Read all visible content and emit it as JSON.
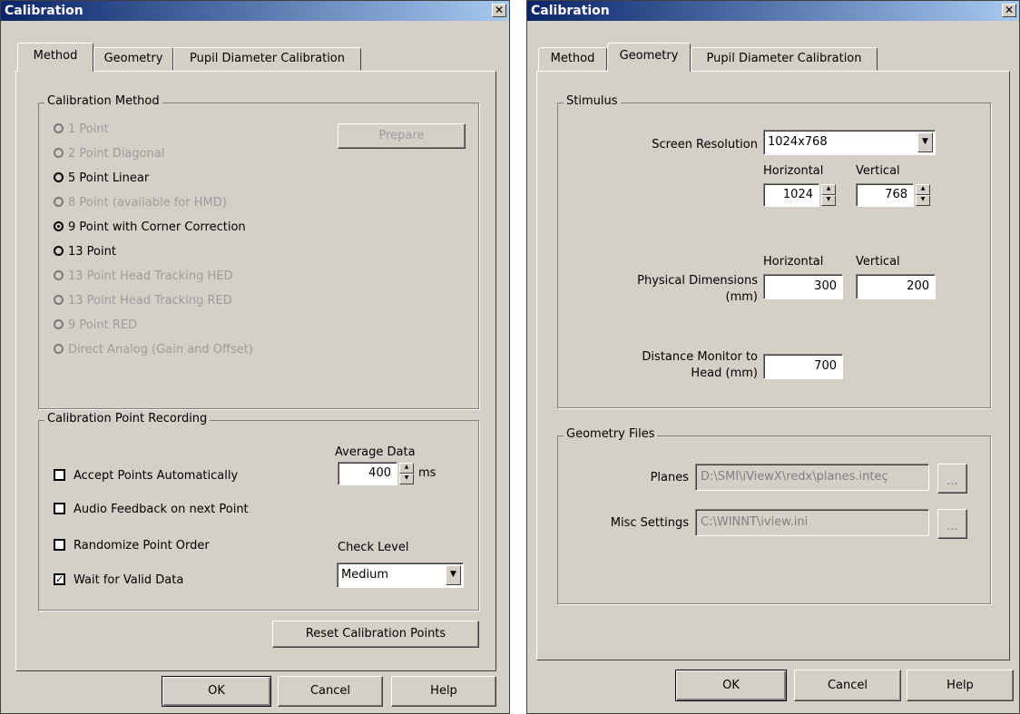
{
  "left": {
    "title": "Calibration",
    "close": "✕",
    "tabs": [
      "Method",
      "Geometry",
      "Pupil Diameter Calibration"
    ],
    "method_group": {
      "label": "Calibration Method",
      "prepare": "Prepare",
      "options": [
        {
          "label": "1 Point",
          "enabled": false,
          "selected": false
        },
        {
          "label": "2 Point Diagonal",
          "enabled": false,
          "selected": false
        },
        {
          "label": "5 Point Linear",
          "enabled": true,
          "selected": false
        },
        {
          "label": "8 Point (available for HMD)",
          "enabled": false,
          "selected": false
        },
        {
          "label": "9 Point with Corner Correction",
          "enabled": true,
          "selected": true
        },
        {
          "label": "13 Point",
          "enabled": true,
          "selected": false
        },
        {
          "label": "13 Point Head Tracking HED",
          "enabled": false,
          "selected": false
        },
        {
          "label": "13 Point Head Tracking RED",
          "enabled": false,
          "selected": false
        },
        {
          "label": "9 Point RED",
          "enabled": false,
          "selected": false
        },
        {
          "label": "Direct Analog (Gain and Offset)",
          "enabled": false,
          "selected": false
        }
      ]
    },
    "recording_group": {
      "label": "Calibration Point Recording",
      "accept": "Accept Points Automatically",
      "audio": "Audio Feedback on next Point",
      "randomize": "Randomize Point Order",
      "wait": "Wait for Valid Data",
      "wait_checked": "✓",
      "avg_label": "Average Data",
      "avg_value": "400",
      "avg_unit": "ms",
      "check_label": "Check Level",
      "check_value": "Medium"
    },
    "reset": "Reset Calibration Points",
    "ok": "OK",
    "cancel": "Cancel",
    "help": "Help"
  },
  "right": {
    "title": "Calibration",
    "close": "✕",
    "tabs": [
      "Method",
      "Geometry",
      "Pupil Diameter Calibration"
    ],
    "stimulus": {
      "label": "Stimulus",
      "screen_res_label": "Screen Resolution",
      "screen_res_value": "1024x768",
      "horizontal": "Horizontal",
      "vertical": "Vertical",
      "res_h": "1024",
      "res_v": "768",
      "phys_label_1": "Physical Dimensions",
      "phys_label_2": "(mm)",
      "phys_h": "300",
      "phys_v": "200",
      "dist_label_1": "Distance Monitor to",
      "dist_label_2": "Head (mm)",
      "dist_value": "700"
    },
    "files": {
      "label": "Geometry Files",
      "planes_label": "Planes",
      "planes_value": "D:\\SMI\\iViewX\\redx\\planes.inteç",
      "misc_label": "Misc Settings",
      "misc_value": "C:\\WINNT\\iview.ini",
      "browse": "..."
    },
    "ok": "OK",
    "cancel": "Cancel",
    "help": "Help"
  }
}
